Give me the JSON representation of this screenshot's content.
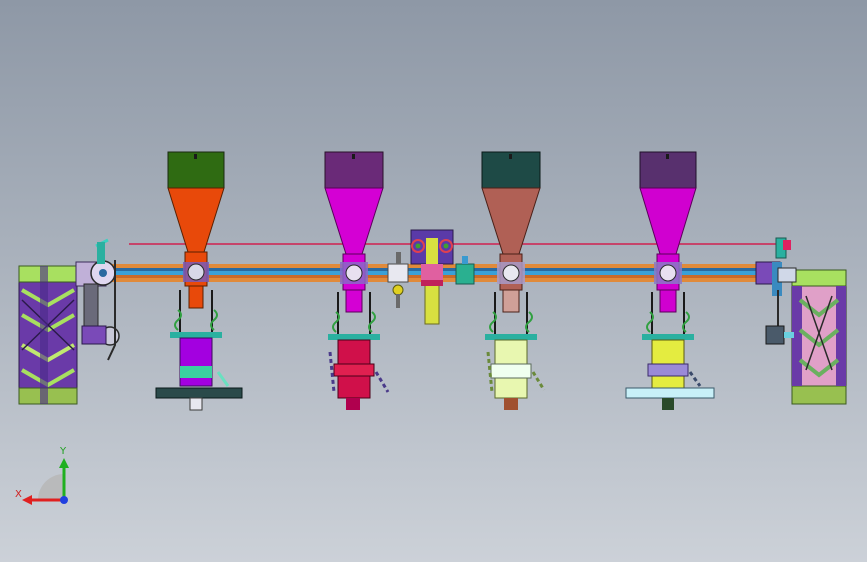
{
  "viewport": {
    "axis_triad": {
      "x_label": "X",
      "y_label": "Y"
    }
  },
  "model": {
    "hopper_units": [
      {
        "id": "unit-1",
        "lid_color": "#2f6b12",
        "funnel_color": "#e8490a",
        "tube_color": "#7a00c8",
        "body_color": "#a300e0",
        "base": "plate"
      },
      {
        "id": "unit-2",
        "lid_color": "#6a2a78",
        "funnel_color": "#d400d4",
        "tube_color": "#b0004e",
        "body_color": "#d0104a",
        "base": "roller"
      },
      {
        "id": "unit-3",
        "lid_color": "#1e4a46",
        "funnel_color": "#b06055",
        "tube_color": "#c8e888",
        "body_color": "#e8f7b0",
        "base": "roller"
      },
      {
        "id": "unit-4",
        "lid_color": "#58306e",
        "funnel_color": "#d000d0",
        "tube_color": "#d4e000",
        "body_color": "#e4ec40",
        "base": "plate"
      }
    ],
    "colors": {
      "shaft_orange": "#e08a3a",
      "shaft_blue": "#3aa0d8",
      "red_line": "#d02050",
      "wheel_green": "#a8e060",
      "wheel_purple": "#6a3aa8",
      "frame_teal": "#2ab0a0",
      "center_box": "#5a3aa8",
      "center_post": "#d8e040"
    }
  }
}
